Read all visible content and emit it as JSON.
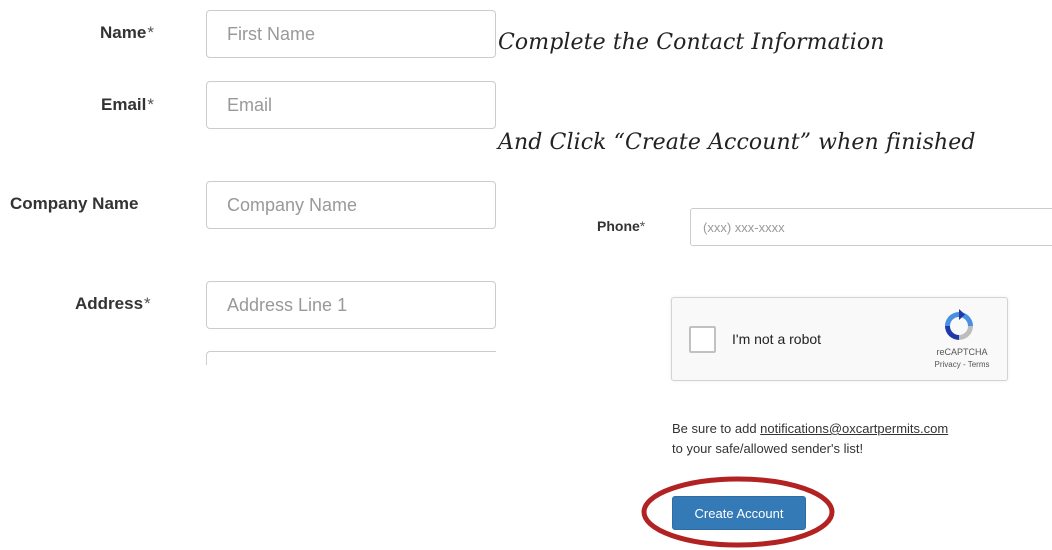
{
  "form": {
    "name": {
      "label": "Name",
      "required": "*",
      "placeholder": "First Name"
    },
    "email": {
      "label": "Email",
      "required": "*",
      "placeholder": "Email"
    },
    "company": {
      "label": "Company Name",
      "placeholder": "Company Name"
    },
    "address": {
      "label": "Address",
      "required": "*",
      "placeholder": "Address Line 1"
    }
  },
  "instructions": {
    "line1": "Complete the Contact Information",
    "line2": "And Click “Create Account” when finished"
  },
  "phone": {
    "label": "Phone",
    "required": "*",
    "placeholder": "(xxx) xxx-xxxx"
  },
  "captcha": {
    "label": "I'm not a robot",
    "brand": "reCAPTCHA",
    "links": "Privacy - Terms"
  },
  "notice": {
    "prefix": "Be sure to add ",
    "email": "notifications@oxcartpermits.com",
    "suffix": " to your safe/allowed sender's list!"
  },
  "create_button": {
    "label": "Create Account"
  },
  "colors": {
    "primary_button": "#337ab7",
    "highlight": "#b22222",
    "captcha_blue": "#4a90e2"
  },
  "icons": {
    "captcha_logo": "recaptcha-logo-icon"
  }
}
